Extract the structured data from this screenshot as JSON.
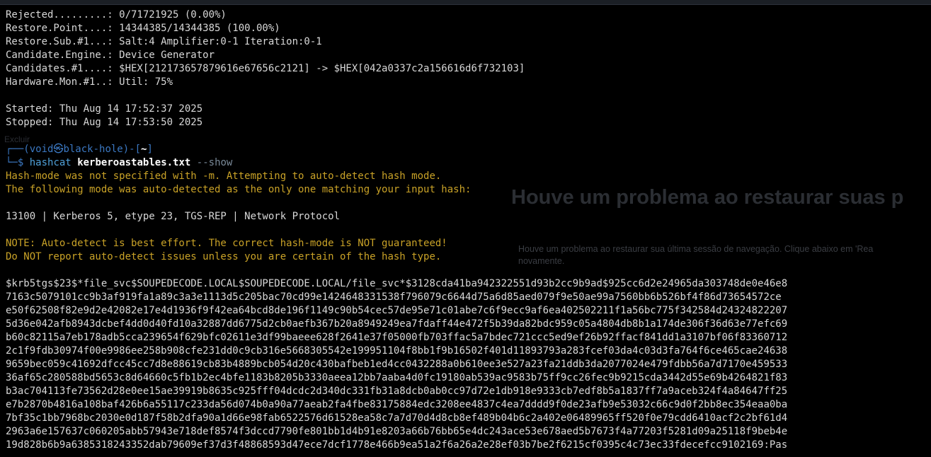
{
  "status": {
    "rejected": "Rejected.........: 0/71721925 (0.00%)",
    "restore_point": "Restore.Point....: 14344385/14344385 (100.00%)",
    "restore_sub": "Restore.Sub.#1...: Salt:4 Amplifier:0-1 Iteration:0-1",
    "candidate_engine": "Candidate.Engine.: Device Generator",
    "candidates": "Candidates.#1....: $HEX[212173657879616e67656c2121] -> $HEX[042a0337c2a156616d6f732103]",
    "hardware_mon": "Hardware.Mon.#1..: Util: 75%",
    "started": "Started: Thu Aug 14 17:52:37 2025",
    "stopped": "Stopped: Thu Aug 14 17:53:50 2025"
  },
  "prompt": {
    "open": "┌──(",
    "user": "void",
    "at": "㉿",
    "host": "black-hole",
    "mid": ")-[",
    "dir": "~",
    "close": "]",
    "corner": "└─",
    "dollar": "$",
    "command": "hashcat",
    "argument": "kerberoastables.txt",
    "option": "--show"
  },
  "output": {
    "warn1": "Hash-mode was not specified with -m. Attempting to auto-detect hash mode.",
    "warn2": "The following mode was auto-detected as the only one matching your input hash:",
    "mode": "13100 | Kerberos 5, etype 23, TGS-REP | Network Protocol",
    "note1": "NOTE: Auto-detect is best effort. The correct hash-mode is NOT guaranteed!",
    "note2": "Do NOT report auto-detect issues unless you are certain of the hash type."
  },
  "hash_lines": [
    "$krb5tgs$23$*file_svc$SOUPEDECODE.LOCAL$SOUPEDECODE.LOCAL/file_svc*$3128cda41ba942322551d93b2cc9b9ad$925cc6d2e24965da303748de0e46e8",
    "7163c5079101cc9b3af919fa1a89c3a3e1113d5c205bac70cd99e1424648331538f796079c6644d75a6d85aed079f9e50ae99a7560bb6b526bf4f86d73654572ce",
    "e50f62508f82e9d2e42082e17e4d1936f9f42ea64bcd8de196f1149c90b54cec57de95e71c01abe7c6f9ecc9af6ea402502211f1a56bc775f342584d24324822207",
    "5d36e042afb8943dcbef4dd0d40fd10a32887dd6775d2cb0aefb367b20a8949249ea7fdaff44e472f5b39da82bdc959c05a4804db8b1a174de306f36d63e77efc69",
    "b60c82115a7eb178adb5cca239654f629bfc02611e3df99baeee628f2641e37f05000fb703ffac5a7bdec721ccc5ed9ef26b92ffacf841dd1a3107bf06f83360712",
    "2c1f9fdb30974f00e9986ee258b908cfe231dd0c9cb316e5668305542e199951104f8bb1f9b16502f401d11893793a283fcef03da4c03d3fa764f6ce465cae24638",
    "9659bec059c41692dfcc45cc7d8e88619cb83b4889bcb054d20c430bafbeb1ed4cc0432288a0b610ee3e527a23fa21ddb3da2077024e479fdbb56a7d7170e459533",
    "36af65c280588bd5653c8d64660c5fb1b2ec4bfe1183b8205b3330aeea12bb7aaba4d0fc19180ab539ac9583b75ff9cc26fec9b9215cda3442d55e69b4264821f83",
    "b3ac704113fe73562d28e0ee15ae39919b8635c925fff04dcdc2d340dc331fb31a8dcb0ab0cc97d72e1db918e9333cb7edf8b5a1837ff7a9aceb324f4a84647ff25",
    "e7b2870b4816a108baf426b6a55117c233da56d074b0a90a77aeab2fa4fbe83175884edc3208ee4837c4ea7dddd9f0de23afb9e53032c66c9d0f2bb8ec354eaa0ba",
    "7bf35c1bb7968bc2030e0d187f58b2dfa90a1d66e98fab6522576d61528ea58c7a7d70d4d8cb8ef489b04b6c2a402e06489965ff520f0e79cdd6410acf2c2bf61d4",
    "2963a6e157637c060205abb57943e718def8574f3dccd7790fe801bb1d4b91e8203a66b76bb65e4dc243ace53e678aed5b7673f4a77203f5281d09a25118f9beb4e",
    "19d828b6b9a6385318243352dab79609ef37d3f48868593d47ece7dcf1778e466b9ea51a2f6a26a2e28ef03b7be2f6215cf0395c4c73ec33fdecefcc9102169:Pas"
  ],
  "background": {
    "title": "Houve um problema ao restaurar suas p",
    "subtitle_1": "Houve um problema ao restaurar sua última sessão de navegação. Clique abaixo em 'Rea",
    "subtitle_2": "novamente.",
    "left_fragment": "Excluir"
  }
}
